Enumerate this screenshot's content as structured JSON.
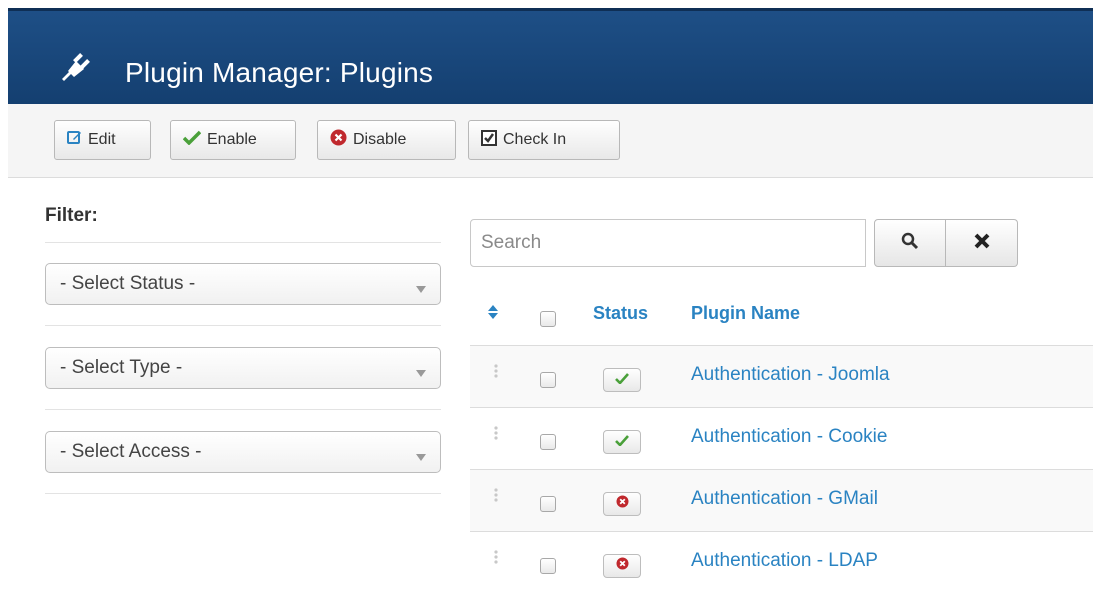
{
  "header": {
    "title": "Plugin Manager: Plugins",
    "icon": "plug-icon"
  },
  "toolbar": {
    "edit_label": "Edit",
    "enable_label": "Enable",
    "disable_label": "Disable",
    "checkin_label": "Check In"
  },
  "filter": {
    "label": "Filter:",
    "status_select": "- Select Status -",
    "type_select": "- Select Type -",
    "access_select": "- Select Access -"
  },
  "search": {
    "placeholder": "Search",
    "value": ""
  },
  "table": {
    "headers": {
      "status": "Status",
      "name": "Plugin Name"
    },
    "rows": [
      {
        "name": "Authentication - Joomla",
        "status": "enabled"
      },
      {
        "name": "Authentication - Cookie",
        "status": "enabled"
      },
      {
        "name": "Authentication - GMail",
        "status": "disabled"
      },
      {
        "name": "Authentication - LDAP",
        "status": "disabled"
      }
    ]
  },
  "colors": {
    "header_bg": "#1a4a80",
    "link": "#2a83c2",
    "enabled": "#4aa03a",
    "disabled": "#c0282d"
  }
}
